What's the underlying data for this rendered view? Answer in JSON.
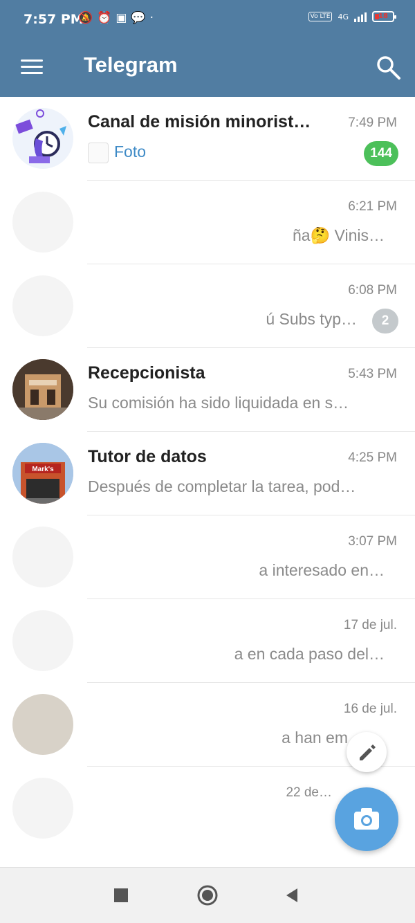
{
  "status_bar": {
    "time": "7:57 PM",
    "icons": [
      "bell-off-icon",
      "alarm-icon",
      "battery-saver-icon",
      "chat-icon",
      "dot-icon"
    ],
    "network_label": "4G",
    "volte_label": "Vo LTE",
    "battery_level": "18"
  },
  "toolbar": {
    "title": "Telegram",
    "menu_icon": "menu-icon",
    "search_icon": "search-icon"
  },
  "chats": [
    {
      "name": "Canal de misión minorist…",
      "time": "7:49 PM",
      "message": "Foto",
      "badge": "144"
    },
    {
      "name": "",
      "time": "6:21 PM",
      "message": "ña🤔 Vinis…",
      "badge": ""
    },
    {
      "name": "",
      "time": "6:08 PM",
      "message": "ú Subs typ…",
      "badge": "2"
    },
    {
      "name": "Recepcionista",
      "time": "5:43 PM",
      "message": "Su comisión ha sido liquidada en s…",
      "badge": ""
    },
    {
      "name": "Tutor de datos",
      "time": "4:25 PM",
      "message": "Después de completar la tarea, pod…",
      "badge": ""
    },
    {
      "name": "",
      "time": "3:07 PM",
      "message": "a interesado en…",
      "badge": ""
    },
    {
      "name": "",
      "time": "17 de jul.",
      "message": "a en cada paso del…",
      "badge": ""
    },
    {
      "name": "",
      "time": "16 de jul.",
      "message": "a han em…",
      "badge": ""
    },
    {
      "name": "",
      "time": "22 de…",
      "message": "",
      "badge": ""
    }
  ],
  "fab": {
    "edit_icon": "pencil-icon",
    "camera_icon": "camera-icon"
  },
  "nav": {
    "recents": "square-icon",
    "home": "circle-icon",
    "back": "triangle-back-icon"
  },
  "colors": {
    "header": "#517da2",
    "unread_badge": "#4cc05a",
    "muted_badge": "#c4c9cc",
    "fab": "#59a3e0",
    "link": "#3e8ac6"
  }
}
